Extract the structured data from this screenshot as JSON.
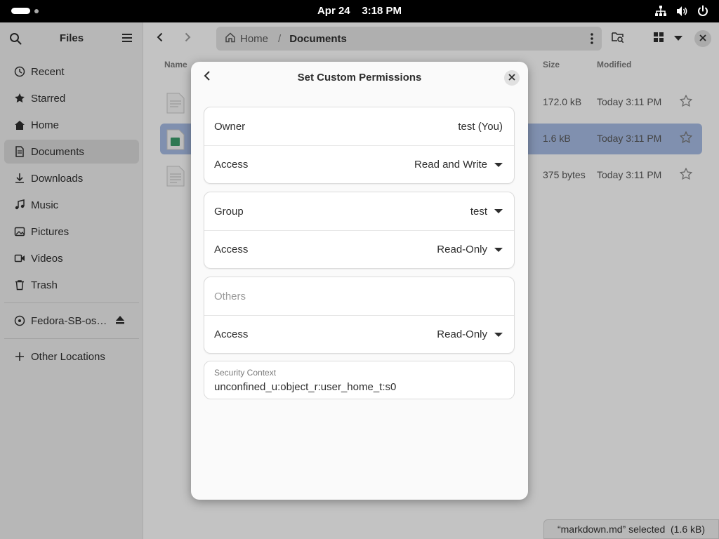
{
  "topbar": {
    "date": "Apr 24",
    "time": "3:18 PM"
  },
  "sidebar": {
    "title": "Files",
    "items": [
      {
        "label": "Recent",
        "icon": "clock-icon"
      },
      {
        "label": "Starred",
        "icon": "star-icon"
      },
      {
        "label": "Home",
        "icon": "home-icon"
      },
      {
        "label": "Documents",
        "icon": "document-icon"
      },
      {
        "label": "Downloads",
        "icon": "download-icon"
      },
      {
        "label": "Music",
        "icon": "music-icon"
      },
      {
        "label": "Pictures",
        "icon": "picture-icon"
      },
      {
        "label": "Videos",
        "icon": "video-icon"
      },
      {
        "label": "Trash",
        "icon": "trash-icon"
      }
    ],
    "device": {
      "label": "Fedora-SB-os…",
      "icon": "disc-icon"
    },
    "other_locations": "Other Locations"
  },
  "pathbar": {
    "home": "Home",
    "separator": "/",
    "current": "Documents"
  },
  "columns": {
    "name": "Name",
    "size": "Size",
    "modified": "Modified"
  },
  "files": [
    {
      "size": "172.0 kB",
      "modified": "Today 3:11 PM",
      "selected": false
    },
    {
      "size": "1.6 kB",
      "modified": "Today 3:11 PM",
      "selected": true
    },
    {
      "size": "375 bytes",
      "modified": "Today 3:11 PM",
      "selected": false
    }
  ],
  "status": "“markdown.md” selected  (1.6 kB)",
  "dialog": {
    "title": "Set Custom Permissions",
    "owner_label": "Owner",
    "owner_value": "test (You)",
    "owner_access_label": "Access",
    "owner_access": "Read and Write",
    "group_label": "Group",
    "group_value": "test",
    "group_access_label": "Access",
    "group_access": "Read-Only",
    "others_label": "Others",
    "others_access_label": "Access",
    "others_access": "Read-Only",
    "security_label": "Security Context",
    "security_value": "unconfined_u:object_r:user_home_t:s0"
  },
  "colors": {
    "accent": "#a4b9e0",
    "topbar": "#000000",
    "sidebar": "#ebebeb"
  }
}
